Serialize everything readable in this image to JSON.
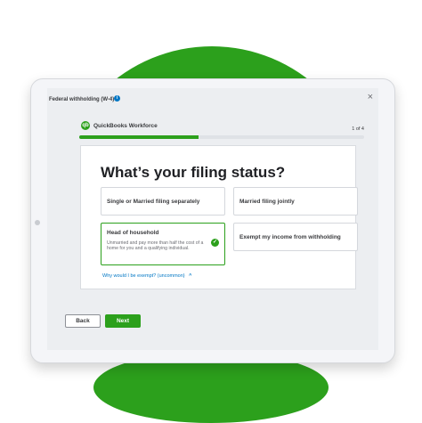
{
  "window": {
    "title": "Federal withholding (W-4)",
    "info_icon": "info-icon",
    "close_icon": "×"
  },
  "brand": {
    "logo_text": "qb",
    "name": "QuickBooks Workforce"
  },
  "progress": {
    "step_text": "1 of 4",
    "fraction": 0.42
  },
  "question": {
    "heading": "What’s your filing status?"
  },
  "options": [
    {
      "label": "Single or Married filing separately",
      "description": "",
      "selected": false
    },
    {
      "label": "Married filing jointly",
      "description": "",
      "selected": false
    },
    {
      "label": "Head of household",
      "description": "Unmarried and pay more than half the cost of a home for you and a qualifying individual.",
      "selected": true
    },
    {
      "label": "Exempt my income from withholding",
      "description": "",
      "selected": false
    }
  ],
  "help_link": "Why would I be exempt? (uncommon)",
  "buttons": {
    "back": "Back",
    "next": "Next"
  },
  "colors": {
    "brand_green": "#2ca01c",
    "link_blue": "#0077c5"
  }
}
